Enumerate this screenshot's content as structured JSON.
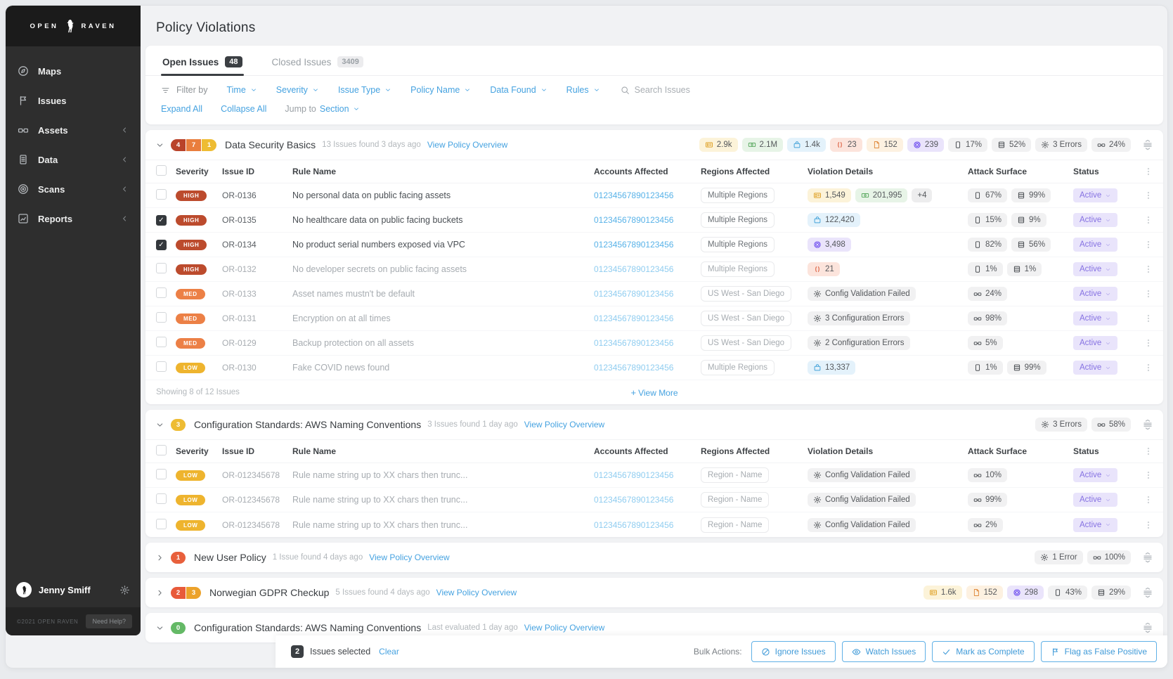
{
  "page_title": "Policy Violations",
  "sidebar": {
    "logo": {
      "left": "OPEN",
      "right": "RAVEN"
    },
    "items": [
      {
        "label": "Maps",
        "icon": "compass",
        "expandable": false
      },
      {
        "label": "Issues",
        "icon": "flag",
        "expandable": false
      },
      {
        "label": "Assets",
        "icon": "glasses",
        "expandable": true
      },
      {
        "label": "Data",
        "icon": "doc-lines",
        "expandable": true
      },
      {
        "label": "Scans",
        "icon": "target",
        "expandable": true
      },
      {
        "label": "Reports",
        "icon": "chart",
        "expandable": true
      }
    ],
    "user": {
      "name": "Jenny Smiff"
    },
    "footer": {
      "copyright": "©2021 OPEN RAVEN",
      "help": "Need Help?"
    }
  },
  "tabs": {
    "open": {
      "label": "Open Issues",
      "count": "48"
    },
    "closed": {
      "label": "Closed Issues",
      "count": "3409"
    }
  },
  "filters": {
    "label": "Filter by",
    "dropdowns": [
      "Time",
      "Severity",
      "Issue Type",
      "Policy Name",
      "Data Found",
      "Rules"
    ],
    "search_placeholder": "Search Issues"
  },
  "toolbar": {
    "expand_all": "Expand All",
    "collapse_all": "Collapse All",
    "jump_label": "Jump to",
    "jump_target": "Section"
  },
  "table_headers": [
    "Severity",
    "Issue ID",
    "Rule Name",
    "Accounts Affected",
    "Regions Affected",
    "Violation Details",
    "Attack Surface",
    "Status"
  ],
  "severity_colors": {
    "HIGH": "#bc4b2d",
    "MED": "#ec8046",
    "LOW": "#eeb42e"
  },
  "status_colors": {
    "bg": "#e9e4fb",
    "fg": "#8672e2"
  },
  "accent_blue": "#45a2e0",
  "badge_styles": {
    "yellow": {
      "bg": "#fcf3d9",
      "ic": "#dfa32a"
    },
    "green": {
      "bg": "#e7f4e7",
      "ic": "#58a85e"
    },
    "blue": {
      "bg": "#e4f2fb",
      "ic": "#44a3d9"
    },
    "red": {
      "bg": "#fce4dc",
      "ic": "#d8512f"
    },
    "cream": {
      "bg": "#fdf1e1",
      "ic": "#e08b3e"
    },
    "purple": {
      "bg": "#eae4fb",
      "ic": "#7a5cf0"
    },
    "gray": {
      "bg": "#f1f1f2",
      "ic": "#4a4e52"
    },
    "plain": {
      "bg": "#ededee",
      "ic": "#55585c"
    }
  },
  "groups": [
    {
      "title": "Data Security Basics",
      "meta": "13 Issues found 3 days ago",
      "link": "View Policy Overview",
      "collapsed": false,
      "counts": [
        {
          "value": "4",
          "color": "#b9432a"
        },
        {
          "value": "7",
          "color": "#e97e3d"
        },
        {
          "value": "1",
          "color": "#eebc33"
        }
      ],
      "badges": [
        {
          "icon": "id-card",
          "text": "2.9k",
          "style": "yellow"
        },
        {
          "icon": "banknote",
          "text": "2.1M",
          "style": "green"
        },
        {
          "icon": "bag",
          "text": "1.4k",
          "style": "blue"
        },
        {
          "icon": "code",
          "text": "23",
          "style": "red"
        },
        {
          "icon": "doc",
          "text": "152",
          "style": "cream"
        },
        {
          "icon": "atom",
          "text": "239",
          "style": "purple"
        },
        {
          "icon": "page",
          "text": "17%",
          "style": "gray"
        },
        {
          "icon": "server",
          "text": "52%",
          "style": "gray"
        },
        {
          "icon": "gear",
          "text": "3 Errors",
          "style": "gray"
        },
        {
          "icon": "glasses",
          "text": "24%",
          "style": "gray"
        }
      ],
      "rows": [
        {
          "checked": false,
          "muted": false,
          "severity": "HIGH",
          "issue_id": "OR-0136",
          "rule": "No personal data on public facing assets",
          "account": "01234567890123456",
          "region": "Multiple Regions",
          "violations": [
            {
              "icon": "id-card",
              "text": "1,549",
              "style": "yellow"
            },
            {
              "icon": "banknote",
              "text": "201,995",
              "style": "green"
            },
            {
              "icon": "",
              "text": "+4",
              "style": "plain"
            }
          ],
          "attack": [
            {
              "icon": "page",
              "text": "67%"
            },
            {
              "icon": "server",
              "text": "99%"
            }
          ],
          "status": "Active"
        },
        {
          "checked": true,
          "muted": false,
          "severity": "HIGH",
          "issue_id": "OR-0135",
          "rule": "No healthcare data on public facing buckets",
          "account": "01234567890123456",
          "region": "Multiple Regions",
          "violations": [
            {
              "icon": "bag",
              "text": "122,420",
              "style": "blue"
            }
          ],
          "attack": [
            {
              "icon": "page",
              "text": "15%"
            },
            {
              "icon": "server",
              "text": "9%"
            }
          ],
          "status": "Active"
        },
        {
          "checked": true,
          "muted": false,
          "severity": "HIGH",
          "issue_id": "OR-0134",
          "rule": "No product serial numbers exposed via VPC",
          "account": "01234567890123456",
          "region": "Multiple Regions",
          "violations": [
            {
              "icon": "atom",
              "text": "3,498",
              "style": "purple"
            }
          ],
          "attack": [
            {
              "icon": "page",
              "text": "82%"
            },
            {
              "icon": "server",
              "text": "56%"
            }
          ],
          "status": "Active"
        },
        {
          "checked": false,
          "muted": true,
          "severity": "HIGH",
          "issue_id": "OR-0132",
          "rule": "No developer secrets on public facing assets",
          "account": "01234567890123456",
          "region": "Multiple Regions",
          "violations": [
            {
              "icon": "code",
              "text": "21",
              "style": "red"
            }
          ],
          "attack": [
            {
              "icon": "page",
              "text": "1%"
            },
            {
              "icon": "server",
              "text": "1%"
            }
          ],
          "status": "Active"
        },
        {
          "checked": false,
          "muted": true,
          "severity": "MED",
          "issue_id": "OR-0133",
          "rule": "Asset names mustn't be default",
          "account": "01234567890123456",
          "region": "US West - San Diego",
          "violations": [
            {
              "icon": "gear",
              "text": "Config Validation Failed",
              "style": "gray"
            }
          ],
          "attack": [
            {
              "icon": "glasses",
              "text": "24%"
            }
          ],
          "status": "Active"
        },
        {
          "checked": false,
          "muted": true,
          "severity": "MED",
          "issue_id": "OR-0131",
          "rule": "Encryption on at all times",
          "account": "01234567890123456",
          "region": "US West - San Diego",
          "violations": [
            {
              "icon": "gear",
              "text": "3 Configuration Errors",
              "style": "gray"
            }
          ],
          "attack": [
            {
              "icon": "glasses",
              "text": "98%"
            }
          ],
          "status": "Active"
        },
        {
          "checked": false,
          "muted": true,
          "severity": "MED",
          "issue_id": "OR-0129",
          "rule": "Backup protection on all assets",
          "account": "01234567890123456",
          "region": "US West - San Diego",
          "violations": [
            {
              "icon": "gear",
              "text": "2 Configuration Errors",
              "style": "gray"
            }
          ],
          "attack": [
            {
              "icon": "glasses",
              "text": "5%"
            }
          ],
          "status": "Active"
        },
        {
          "checked": false,
          "muted": true,
          "severity": "LOW",
          "issue_id": "OR-0130",
          "rule": "Fake COVID news found",
          "account": "01234567890123456",
          "region": "Multiple Regions",
          "violations": [
            {
              "icon": "bag",
              "text": "13,337",
              "style": "blue"
            }
          ],
          "attack": [
            {
              "icon": "page",
              "text": "1%"
            },
            {
              "icon": "server",
              "text": "99%"
            }
          ],
          "status": "Active"
        }
      ],
      "footer": {
        "showing": "Showing 8 of 12 Issues",
        "view_more": "View More"
      }
    },
    {
      "title": "Configuration Standards: AWS Naming Conventions",
      "meta": "3 Issues found 1 day ago",
      "link": "View Policy Overview",
      "collapsed": false,
      "counts": [
        {
          "value": "3",
          "color": "#eebc33"
        }
      ],
      "badges": [
        {
          "icon": "gear",
          "text": "3 Errors",
          "style": "gray"
        },
        {
          "icon": "glasses",
          "text": "58%",
          "style": "gray"
        }
      ],
      "rows": [
        {
          "checked": false,
          "muted": true,
          "severity": "LOW",
          "issue_id": "OR-012345678",
          "rule": "Rule name string up to XX chars then trunc...",
          "account": "01234567890123456",
          "region": "Region - Name",
          "violations": [
            {
              "icon": "gear",
              "text": "Config Validation Failed",
              "style": "gray"
            }
          ],
          "attack": [
            {
              "icon": "glasses",
              "text": "10%"
            }
          ],
          "status": "Active"
        },
        {
          "checked": false,
          "muted": true,
          "severity": "LOW",
          "issue_id": "OR-012345678",
          "rule": "Rule name string up to XX chars then trunc...",
          "account": "01234567890123456",
          "region": "Region - Name",
          "violations": [
            {
              "icon": "gear",
              "text": "Config Validation Failed",
              "style": "gray"
            }
          ],
          "attack": [
            {
              "icon": "glasses",
              "text": "99%"
            }
          ],
          "status": "Active"
        },
        {
          "checked": false,
          "muted": true,
          "severity": "LOW",
          "issue_id": "OR-012345678",
          "rule": "Rule name string up to XX chars then trunc...",
          "account": "01234567890123456",
          "region": "Region - Name",
          "violations": [
            {
              "icon": "gear",
              "text": "Config Validation Failed",
              "style": "gray"
            }
          ],
          "attack": [
            {
              "icon": "glasses",
              "text": "2%"
            }
          ],
          "status": "Active"
        }
      ]
    },
    {
      "title": "New User Policy",
      "meta": "1 Issue found 4 days ago",
      "link": "View Policy Overview",
      "collapsed": true,
      "counts": [
        {
          "value": "1",
          "color": "#e8603c"
        }
      ],
      "badges": [
        {
          "icon": "gear",
          "text": "1 Error",
          "style": "gray"
        },
        {
          "icon": "glasses",
          "text": "100%",
          "style": "gray"
        }
      ],
      "rows": []
    },
    {
      "title": "Norwegian GDPR Checkup",
      "meta": "5 Issues found 4 days ago",
      "link": "View Policy Overview",
      "collapsed": true,
      "counts": [
        {
          "value": "2",
          "color": "#e85a3a"
        },
        {
          "value": "3",
          "color": "#eca22a"
        }
      ],
      "badges": [
        {
          "icon": "id-card",
          "text": "1.6k",
          "style": "yellow"
        },
        {
          "icon": "doc",
          "text": "152",
          "style": "cream"
        },
        {
          "icon": "atom",
          "text": "298",
          "style": "purple"
        },
        {
          "icon": "page",
          "text": "43%",
          "style": "gray"
        },
        {
          "icon": "server",
          "text": "29%",
          "style": "gray"
        }
      ],
      "rows": []
    },
    {
      "title": "Configuration Standards: AWS Naming Conventions",
      "meta": "Last evaluated 1 day ago",
      "link": "View Policy Overview",
      "collapsed": false,
      "counts": [
        {
          "value": "0",
          "color": "#64b966"
        }
      ],
      "badges": [],
      "rows": []
    }
  ],
  "bulk_bar": {
    "count": "2",
    "selected_label": "Issues selected",
    "clear_label": "Clear",
    "actions_label": "Bulk Actions:",
    "actions": [
      {
        "icon": "ignore",
        "label": "Ignore Issues"
      },
      {
        "icon": "eye",
        "label": "Watch Issues"
      },
      {
        "icon": "check",
        "label": "Mark as Complete"
      },
      {
        "icon": "flag",
        "label": "Flag as False Positive"
      }
    ]
  }
}
